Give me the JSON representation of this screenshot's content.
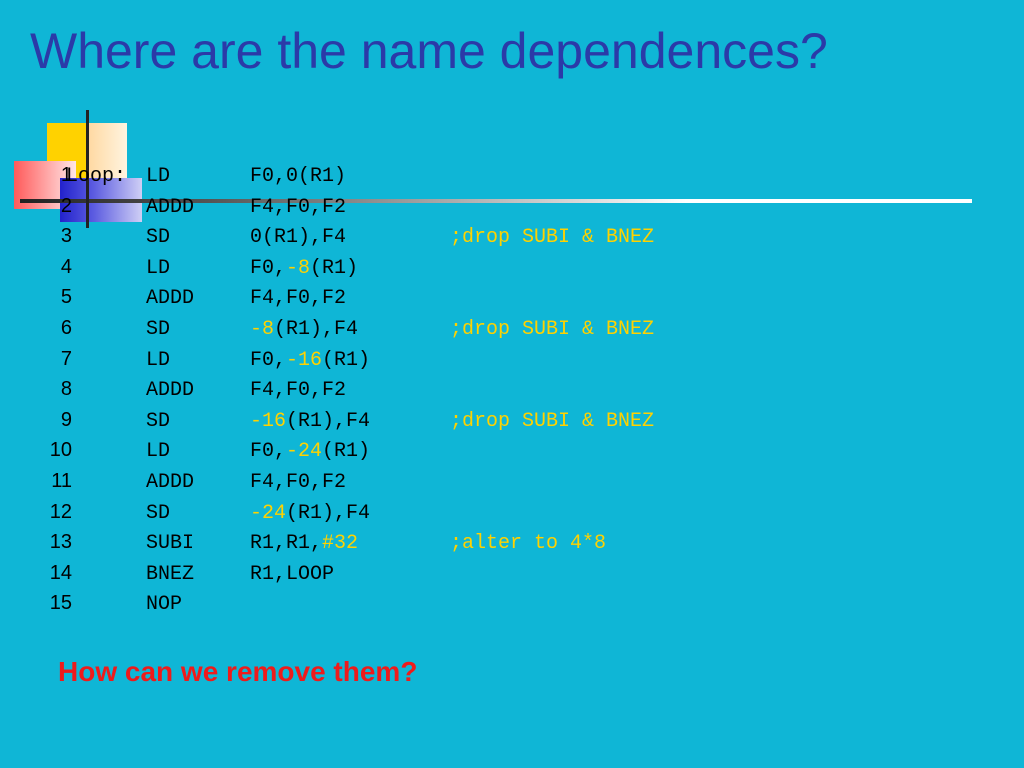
{
  "title": "Where are the name dependences?",
  "question": "How can we remove them?",
  "colors": {
    "background": "#0fb6d6",
    "title": "#2b3aa8",
    "highlight": "#ffd200",
    "question": "#ee1b1b"
  },
  "code": [
    {
      "num": "1",
      "label": "Loop:",
      "op": "LD",
      "args": [
        {
          "t": "F0,0(R1)"
        }
      ],
      "comment": ""
    },
    {
      "num": "2",
      "label": "",
      "op": "ADDD",
      "args": [
        {
          "t": "F4,F0,F2"
        }
      ],
      "comment": ""
    },
    {
      "num": "3",
      "label": "",
      "op": "SD",
      "args": [
        {
          "t": "0(R1),F4"
        }
      ],
      "comment": ";drop SUBI & BNEZ"
    },
    {
      "num": "4",
      "label": "",
      "op": "LD",
      "args": [
        {
          "t": "F0,"
        },
        {
          "t": "-8",
          "hl": true
        },
        {
          "t": "(R1)"
        }
      ],
      "comment": ""
    },
    {
      "num": "5",
      "label": "",
      "op": "ADDD",
      "args": [
        {
          "t": "F4,F0,F2"
        }
      ],
      "comment": ""
    },
    {
      "num": "6",
      "label": "",
      "op": "SD",
      "args": [
        {
          "t": "-8",
          "hl": true
        },
        {
          "t": "(R1),F4"
        }
      ],
      "comment": ";drop SUBI & BNEZ"
    },
    {
      "num": "7",
      "label": "",
      "op": "LD",
      "args": [
        {
          "t": "F0,"
        },
        {
          "t": "-16",
          "hl": true
        },
        {
          "t": "(R1)"
        }
      ],
      "comment": ""
    },
    {
      "num": "8",
      "label": "",
      "op": "ADDD",
      "args": [
        {
          "t": "F4,F0,F2"
        }
      ],
      "comment": ""
    },
    {
      "num": "9",
      "label": "",
      "op": "SD",
      "args": [
        {
          "t": "-16",
          "hl": true
        },
        {
          "t": "(R1),F4"
        }
      ],
      "comment": ";drop SUBI & BNEZ"
    },
    {
      "num": "10",
      "label": "",
      "op": "LD",
      "args": [
        {
          "t": "F0,"
        },
        {
          "t": "-24",
          "hl": true
        },
        {
          "t": "(R1)"
        }
      ],
      "comment": ""
    },
    {
      "num": "11",
      "label": "",
      "op": "ADDD",
      "args": [
        {
          "t": "F4,F0,F2"
        }
      ],
      "comment": ""
    },
    {
      "num": "12",
      "label": "",
      "op": "SD",
      "args": [
        {
          "t": "-24",
          "hl": true
        },
        {
          "t": "(R1),F4"
        }
      ],
      "comment": ""
    },
    {
      "num": "13",
      "label": "",
      "op": "SUBI",
      "args": [
        {
          "t": "R1,R1,"
        },
        {
          "t": "#32",
          "hl": true
        }
      ],
      "comment": ";alter to 4*8"
    },
    {
      "num": "14",
      "label": "",
      "op": "BNEZ",
      "args": [
        {
          "t": "R1,LOOP"
        }
      ],
      "comment": ""
    },
    {
      "num": "15",
      "label": "",
      "op": "NOP",
      "args": [
        {
          "t": ""
        }
      ],
      "comment": ""
    }
  ]
}
